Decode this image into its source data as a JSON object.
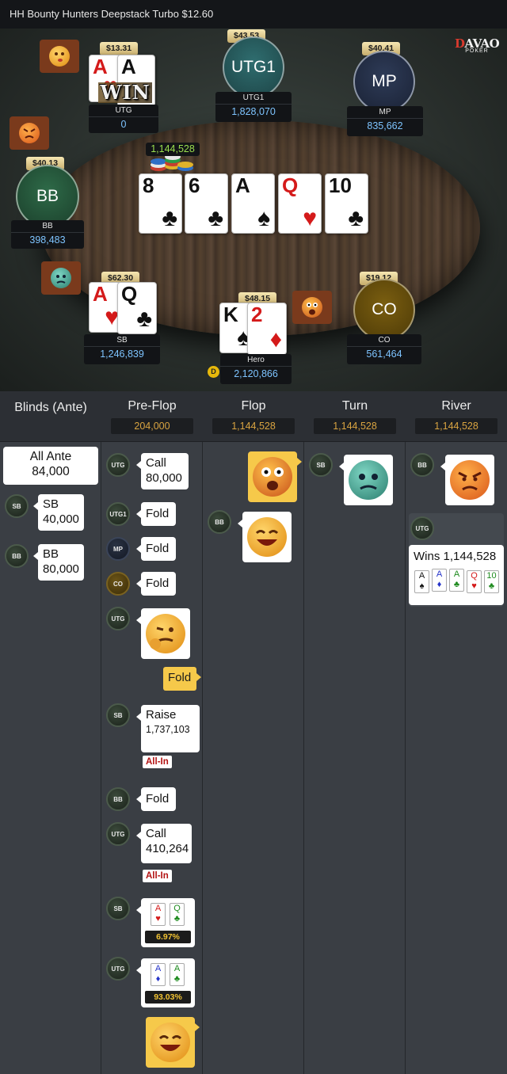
{
  "header": {
    "title": "HH  Bounty Hunters Deepstack Turbo $12.60"
  },
  "logo": {
    "top_a": "D",
    "top_b": "AVAO",
    "sub": "POKER"
  },
  "table": {
    "seats": {
      "utg": {
        "stack_usd": "$13.31",
        "name": "UTG",
        "chips": "0",
        "cards": [
          {
            "rank": "A",
            "suit": "♥",
            "color": "red"
          },
          {
            "rank": "A",
            "suit": "♠",
            "color": "black"
          }
        ],
        "win_label": "WIN"
      },
      "utg1": {
        "stack_usd": "$43.53",
        "avatar": "UTG1",
        "name": "UTG1",
        "chips": "1,828,070"
      },
      "mp": {
        "stack_usd": "$40.41",
        "avatar": "MP",
        "name": "MP",
        "chips": "835,662"
      },
      "bb": {
        "stack_usd": "$40.13",
        "avatar": "BB",
        "name": "BB",
        "chips": "398,483"
      },
      "sb": {
        "stack_usd": "$62.30",
        "name": "SB",
        "chips": "1,246,839",
        "cards": [
          {
            "rank": "A",
            "suit": "♥",
            "color": "red"
          },
          {
            "rank": "Q",
            "suit": "♣",
            "color": "black"
          }
        ]
      },
      "hero": {
        "stack_usd": "$48.15",
        "name": "Hero",
        "chips": "2,120,866",
        "cards": [
          {
            "rank": "K",
            "suit": "♠",
            "color": "black"
          },
          {
            "rank": "2",
            "suit": "♦",
            "color": "red"
          }
        ],
        "dealer": "D"
      },
      "co": {
        "stack_usd": "$19.12",
        "avatar": "CO",
        "name": "CO",
        "chips": "561,464"
      }
    },
    "board": [
      {
        "rank": "8",
        "suit": "♣",
        "color": "black"
      },
      {
        "rank": "6",
        "suit": "♣",
        "color": "black"
      },
      {
        "rank": "A",
        "suit": "♠",
        "color": "black"
      },
      {
        "rank": "Q",
        "suit": "♥",
        "color": "red"
      },
      {
        "rank": "10",
        "suit": "♣",
        "color": "black"
      }
    ],
    "pot": "1,144,528"
  },
  "history": {
    "columns": [
      {
        "title": "Blinds (Ante)",
        "pot": ""
      },
      {
        "title": "Pre-Flop",
        "pot": "204,000"
      },
      {
        "title": "Flop",
        "pot": "1,144,528"
      },
      {
        "title": "Turn",
        "pot": "1,144,528"
      },
      {
        "title": "River",
        "pot": "1,144,528"
      }
    ],
    "blinds": {
      "ante_label": "All Ante",
      "ante_amount": "84,000",
      "sb_badge": "SB",
      "sb_label": "SB",
      "sb_amount": "40,000",
      "bb_badge": "BB",
      "bb_label": "BB",
      "bb_amount": "80,000"
    },
    "preflop": {
      "a1": {
        "badge": "UTG",
        "action": "Call",
        "amount": "80,000"
      },
      "a2": {
        "badge": "UTG1",
        "action": "Fold"
      },
      "a3": {
        "badge": "MP",
        "action": "Fold"
      },
      "a4": {
        "badge": "CO",
        "action": "Fold"
      },
      "a5": {
        "badge": "UTG"
      },
      "hero_fold": "Fold",
      "a6": {
        "badge": "SB",
        "action": "Raise",
        "amount": "1,737,103",
        "allin": "All-In"
      },
      "a7": {
        "badge": "BB",
        "action": "Fold"
      },
      "a8": {
        "badge": "UTG",
        "action": "Call",
        "amount": "410,264",
        "allin": "All-In"
      },
      "eq_sb": {
        "badge": "SB",
        "c1": "A",
        "s1": "♥",
        "c2": "Q",
        "s2": "♣",
        "pct": "6.97%"
      },
      "eq_utg": {
        "badge": "UTG",
        "c1": "A",
        "s1": "♦",
        "c2": "A",
        "s2": "♣",
        "pct": "93.03%"
      }
    },
    "flop": {
      "bb_badge": "BB"
    },
    "turn": {
      "sb_badge": "SB"
    },
    "river": {
      "bb_badge": "BB",
      "utg_badge": "UTG",
      "wins": "Wins 1,144,528",
      "cards": [
        {
          "rank": "A",
          "suit": "♠",
          "color": "black"
        },
        {
          "rank": "A",
          "suit": "♦",
          "color": "blue"
        },
        {
          "rank": "A",
          "suit": "♣",
          "color": "green"
        },
        {
          "rank": "Q",
          "suit": "♥",
          "color": "red"
        },
        {
          "rank": "10",
          "suit": "♣",
          "color": "green"
        }
      ]
    }
  },
  "icons": {
    "emoji": [
      "kiss-face-icon",
      "angry-face-icon",
      "sick-face-icon",
      "shocked-face-icon",
      "laughing-face-icon",
      "pointing-face-icon"
    ]
  }
}
